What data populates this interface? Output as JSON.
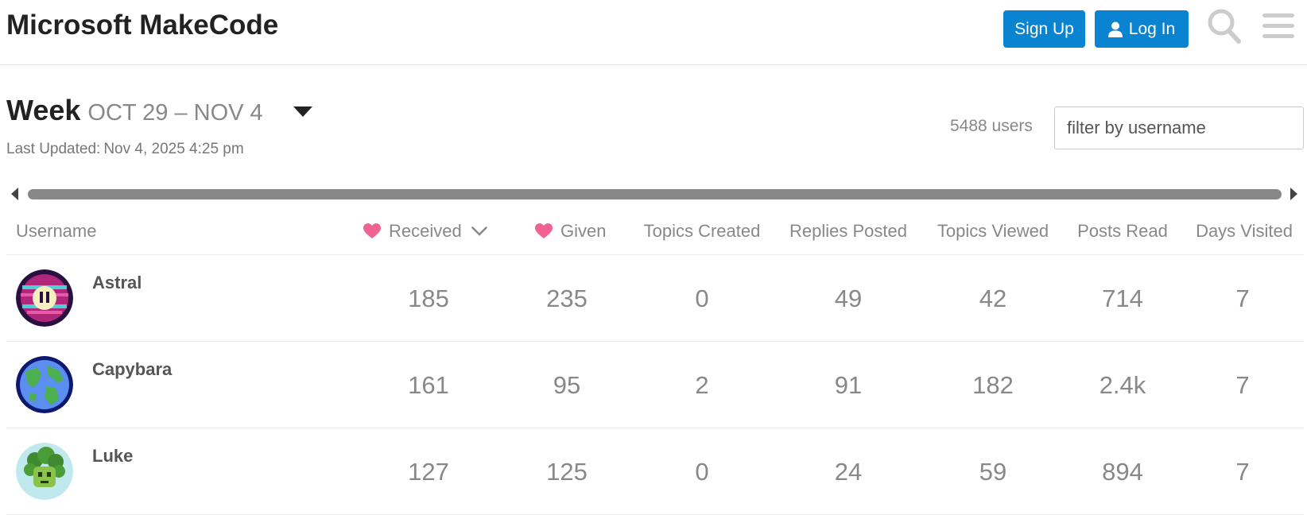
{
  "header": {
    "title": "Microsoft MakeCode",
    "signup_label": "Sign Up",
    "login_label": "Log In",
    "search_icon": "search-icon",
    "menu_icon": "hamburger-menu-icon",
    "accent_color": "#0a84d0"
  },
  "period": {
    "label": "Week",
    "range": "OCT 29 – NOV 4",
    "last_updated_label": "Last Updated:",
    "last_updated_value": "Nov 4, 2025 4:25 pm"
  },
  "directory": {
    "users_count": "5488 users",
    "filter_placeholder": "filter by username"
  },
  "columns": {
    "username": "Username",
    "received": "Received",
    "given": "Given",
    "topics_created": "Topics Created",
    "replies_posted": "Replies Posted",
    "topics_viewed": "Topics Viewed",
    "posts_read": "Posts Read",
    "days_visited": "Days Visited",
    "heart_color": "#f06292"
  },
  "rows": [
    {
      "username": "Astral",
      "received": "185",
      "given": "235",
      "topics_created": "0",
      "replies_posted": "49",
      "topics_viewed": "42",
      "posts_read": "714",
      "days_visited": "7"
    },
    {
      "username": "Capybara",
      "received": "161",
      "given": "95",
      "topics_created": "2",
      "replies_posted": "91",
      "topics_viewed": "182",
      "posts_read": "2.4k",
      "days_visited": "7"
    },
    {
      "username": "Luke",
      "received": "127",
      "given": "125",
      "topics_created": "0",
      "replies_posted": "24",
      "topics_viewed": "59",
      "posts_read": "894",
      "days_visited": "7"
    }
  ]
}
